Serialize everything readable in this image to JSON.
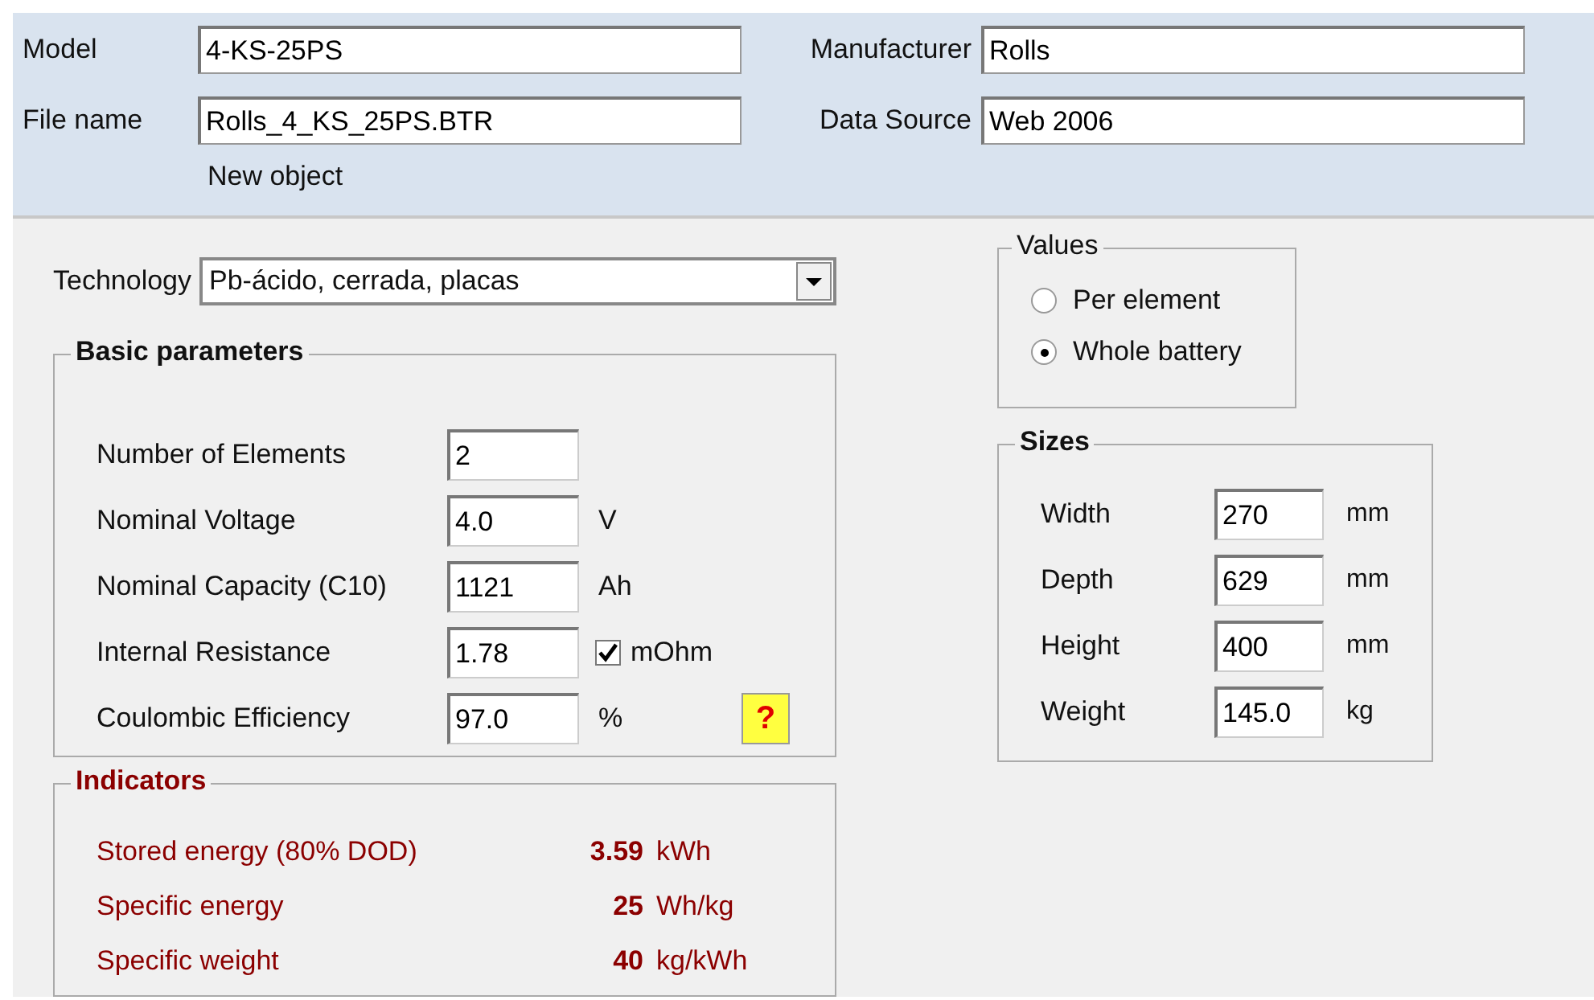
{
  "header": {
    "fields_left": [
      {
        "label": "Model",
        "value": "4-KS-25PS"
      },
      {
        "label": "File name",
        "value": "Rolls_4_KS_25PS.BTR"
      }
    ],
    "fields_right": [
      {
        "label": "Manufacturer",
        "value": "Rolls"
      },
      {
        "label": "Data Source",
        "value": "Web 2006"
      }
    ],
    "status": "New object"
  },
  "technology": {
    "label": "Technology",
    "value": "Pb-ácido, cerrada, placas"
  },
  "basic_parameters": {
    "title": "Basic parameters",
    "rows": [
      {
        "label": "Number of Elements",
        "value": "2"
      },
      {
        "label": "Nominal Voltage",
        "value": "4.0",
        "unit": "V"
      },
      {
        "label": "Nominal Capacity (C10)",
        "value": "1121",
        "unit": "Ah"
      },
      {
        "label": "Internal Resistance",
        "value": "1.78",
        "unit": "mOhm",
        "checked": true
      },
      {
        "label": "Coulombic Efficiency",
        "value": "97.0",
        "unit": "%",
        "help": "?"
      }
    ]
  },
  "indicators": {
    "title": "Indicators",
    "rows": [
      {
        "label": "Stored energy  (80% DOD)",
        "value": "3.59",
        "unit": "kWh"
      },
      {
        "label": "Specific energy",
        "value": "25",
        "unit": "Wh/kg"
      },
      {
        "label": "Specific weight",
        "value": "40",
        "unit": "kg/kWh"
      }
    ]
  },
  "values": {
    "title": "Values",
    "options": [
      {
        "label": "Per element",
        "selected": false
      },
      {
        "label": "Whole battery",
        "selected": true
      }
    ]
  },
  "sizes": {
    "title": "Sizes",
    "rows": [
      {
        "label": "Width",
        "value": "270",
        "unit": "mm"
      },
      {
        "label": "Depth",
        "value": "629",
        "unit": "mm"
      },
      {
        "label": "Height",
        "value": "400",
        "unit": "mm"
      },
      {
        "label": "Weight",
        "value": "145.0",
        "unit": "kg"
      }
    ]
  }
}
